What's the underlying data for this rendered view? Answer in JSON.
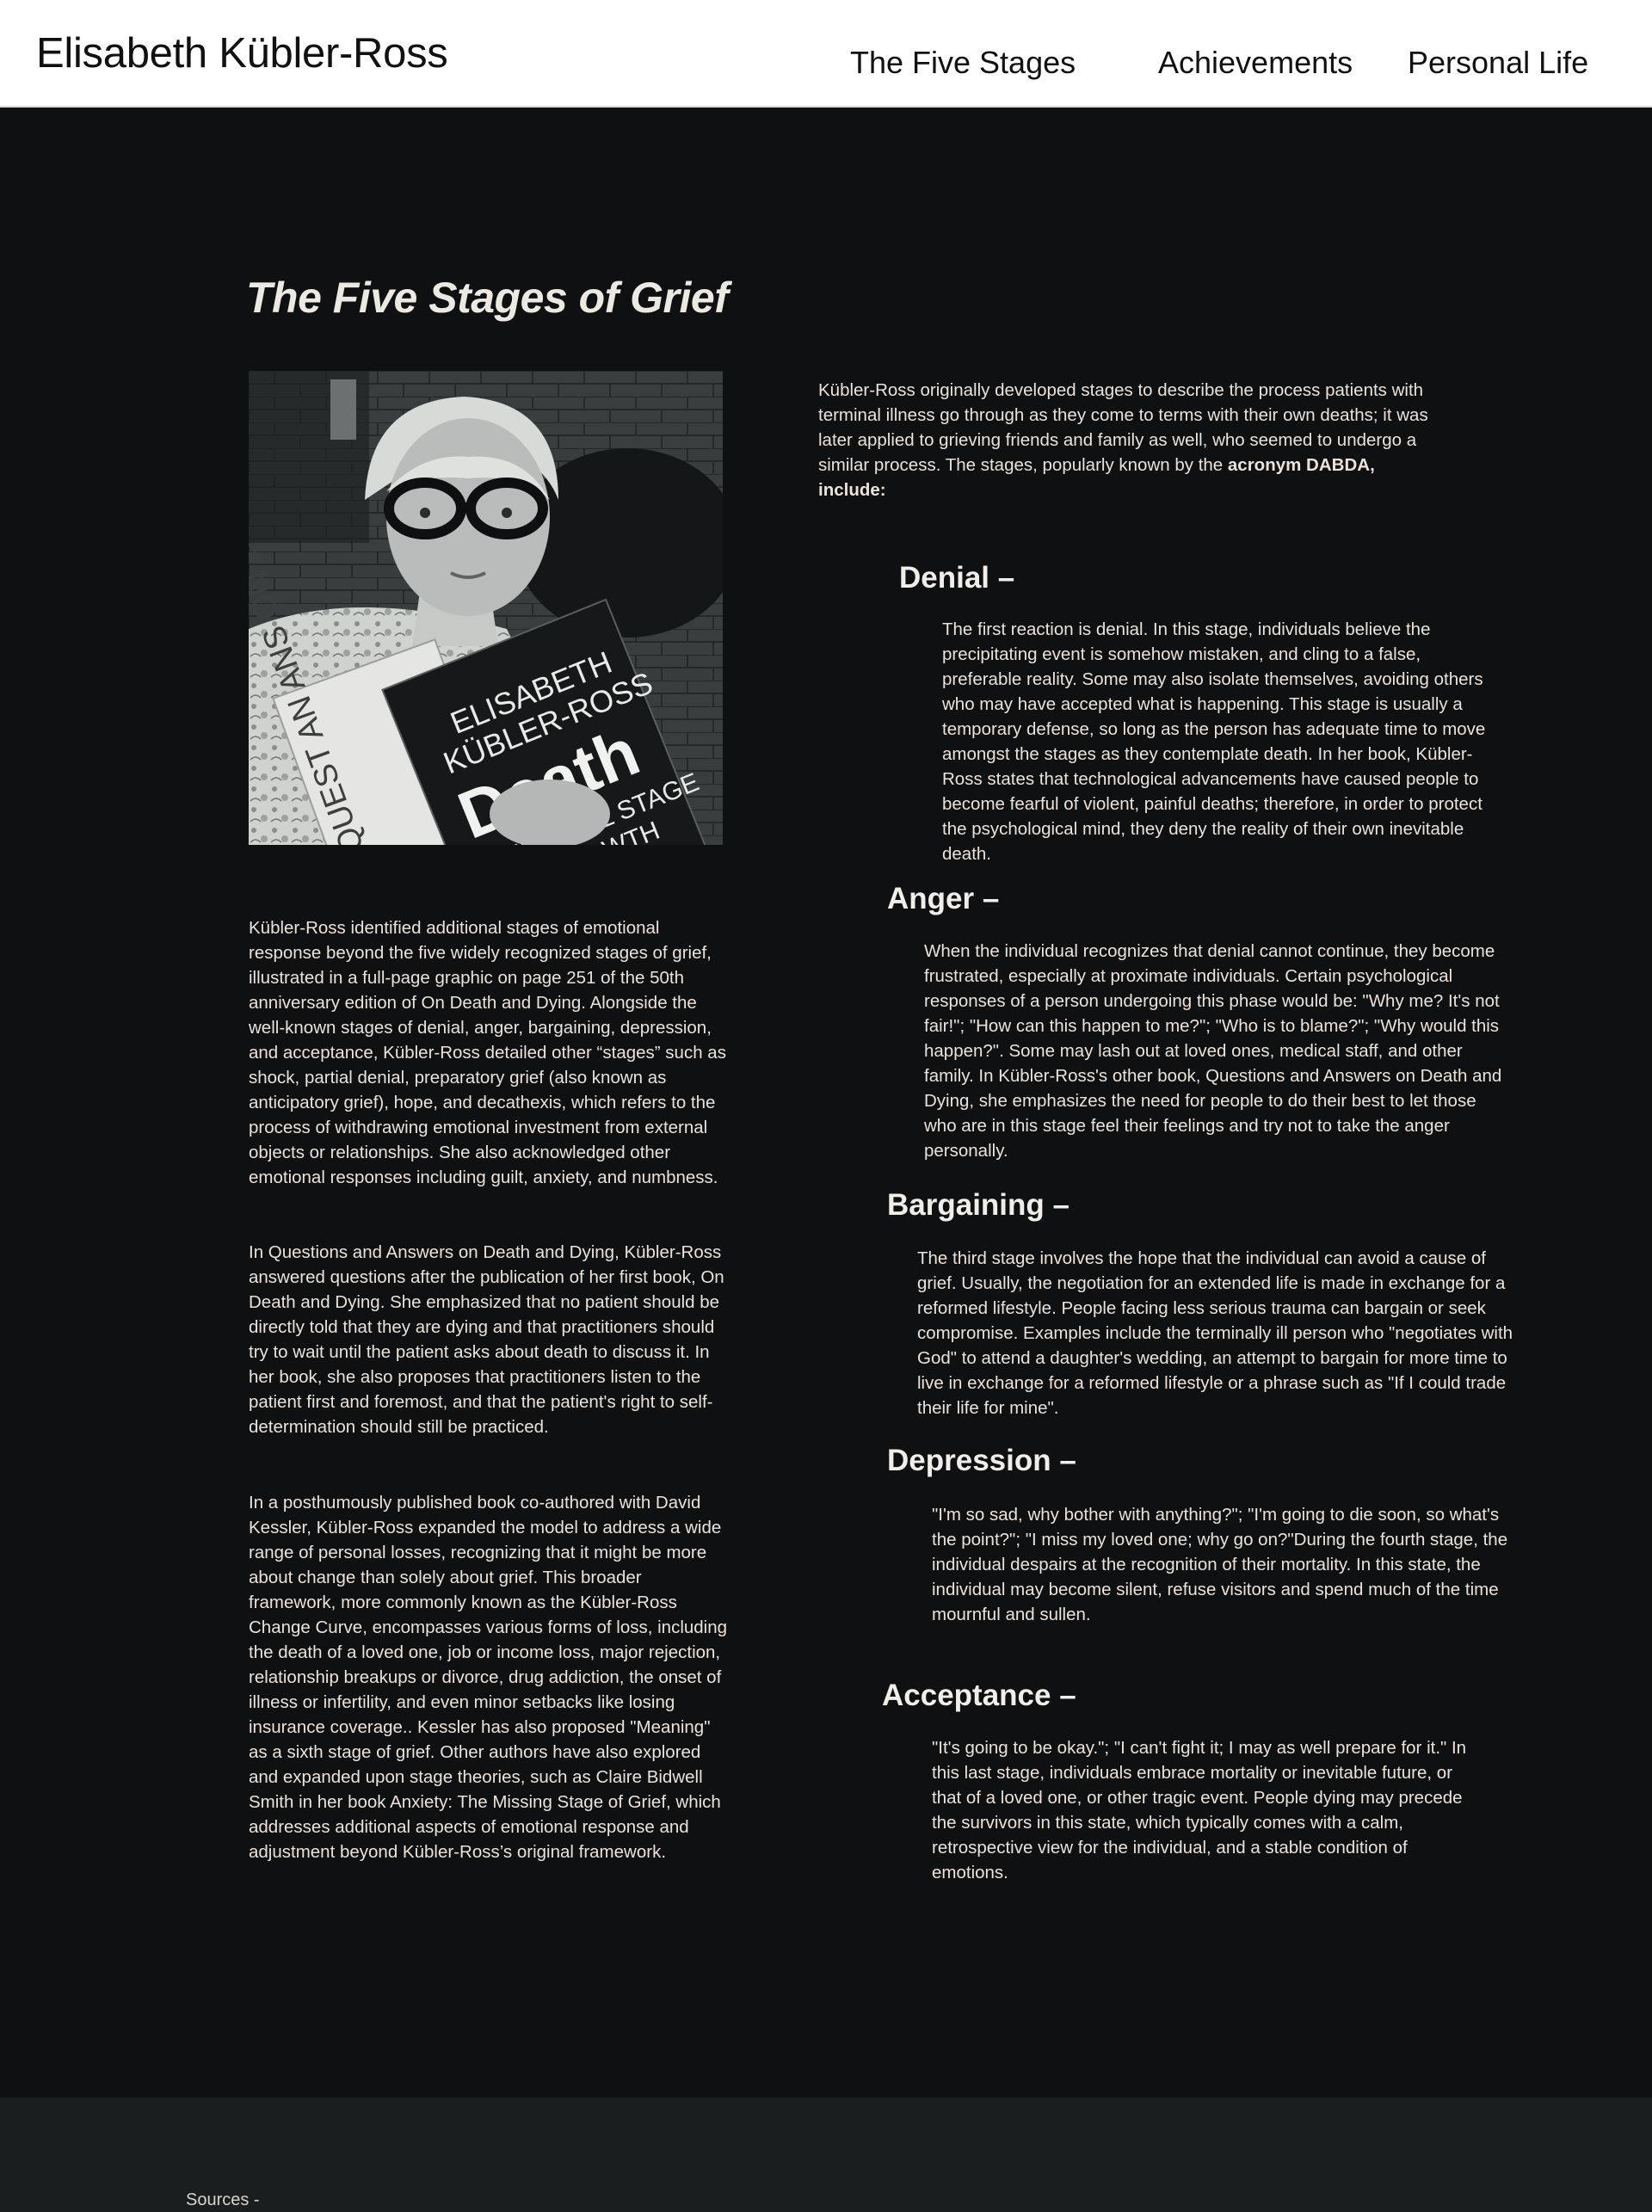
{
  "header": {
    "site_title": "Elisabeth Kübler-Ross",
    "nav": [
      {
        "label": "The Five Stages"
      },
      {
        "label": "Achievements"
      },
      {
        "label": "Personal Life"
      }
    ]
  },
  "main": {
    "title": "The Five Stages of Grief",
    "intro": {
      "text": "Kübler-Ross originally developed stages to describe the process patients with terminal illness go through as they come to terms with their own deaths; it was later applied to grieving friends and family as well, who seemed to undergo a similar process. The stages, popularly known by the ",
      "bold": "acronym DABDA, include:"
    },
    "portrait": {
      "book_author_line1": "ELISABETH",
      "book_author_line2": "KÜBLER-ROSS",
      "book_title": "Death",
      "book_subtitle_line1": "THE FINAL STAGE",
      "book_subtitle_line2": "OF GROWTH",
      "back_book_text": "QUEST AN ANS ON D"
    },
    "left_paragraphs": [
      "Kübler-Ross identified additional stages of emotional response beyond the five widely recognized stages of grief, illustrated in a full-page graphic on page 251 of the 50th anniversary edition of On Death and Dying. Alongside the well-known stages of denial, anger, bargaining, depression, and acceptance, Kübler-Ross detailed other “stages” such as shock, partial denial, preparatory grief (also known as anticipatory grief), hope, and decathexis, which refers to the process of withdrawing emotional investment from external objects or relationships. She also acknowledged other emotional responses including guilt, anxiety, and numbness.",
      "In Questions and Answers on Death and Dying, Kübler-Ross answered questions after the publication of her first book, On Death and Dying. She emphasized that no patient should be directly told that they are dying and that practitioners should try to wait until the patient asks about death to discuss it. In her book, she also proposes that practitioners listen to the patient first and foremost, and that the patient's right to self-determination should still be practiced.",
      "In a posthumously published book co-authored with David Kessler, Kübler-Ross expanded the model to address a wide range of personal losses, recognizing that it might be more about change than solely about grief. This broader framework, more commonly known as the Kübler-Ross Change Curve, encompasses various forms of loss, including the death of a loved one, job or income loss, major rejection, relationship breakups or divorce, drug addiction, the onset of illness or infertility, and even minor setbacks like losing insurance coverage.. Kessler has also proposed \"Meaning\" as a sixth stage of grief. Other authors have also explored and expanded upon stage theories, such as Claire Bidwell Smith in her book Anxiety: The Missing Stage of Grief, which addresses additional aspects of emotional response and adjustment beyond Kübler-Ross’s original framework."
    ],
    "stages": [
      {
        "heading": "Denial –",
        "text": "The first reaction is denial. In this stage, individuals believe the precipitating event is somehow mistaken, and cling to a false, preferable reality. Some may also isolate themselves, avoiding others who may have accepted what is happening. This stage is usually a temporary defense, so long as the person has adequate time to move amongst the stages as they contemplate death. In her book, Kübler-Ross states that technological advancements have caused people to become fearful of violent, painful deaths; therefore, in order to protect the psychological mind, they deny the reality of their own inevitable death."
      },
      {
        "heading": "Anger –",
        "text": "When the individual recognizes that denial cannot continue, they become frustrated, especially at proximate individuals. Certain psychological responses of a person undergoing this phase would be: \"Why me? It's not fair!\"; \"How can this happen to me?\"; \"Who is to blame?\"; \"Why would this happen?\". Some may lash out at loved ones, medical staff, and other family. In Kübler-Ross's other book, Questions and Answers on Death and Dying, she emphasizes the need for people to do their best to let those who are in this stage feel their feelings and try not to take the anger personally."
      },
      {
        "heading": "Bargaining –",
        "text": "The third stage involves the hope that the individual can avoid a cause of grief. Usually, the negotiation for an extended life is made in exchange for a reformed lifestyle. People facing less serious trauma can bargain or seek compromise. Examples include the terminally ill person who \"negotiates with God\" to attend a daughter's wedding, an attempt to bargain for more time to live in exchange for a reformed lifestyle or a phrase such as \"If I could trade their life for mine\"."
      },
      {
        "heading": "Depression –",
        "text": "\"I'm so sad, why bother with anything?\"; \"I'm going to die soon, so what's the point?\"; \"I miss my loved one; why go on?\"During the fourth stage, the individual despairs at the recognition of their mortality. In this state, the individual may become silent, refuse visitors and spend much of the time mournful and sullen."
      },
      {
        "heading": "Acceptance –",
        "text": "\"It's going to be okay.\"; \"I can't fight it; I may as well prepare for it.\" In this last stage, individuals embrace mortality or inevitable future, or that of a loved one, or other tragic event. People dying may precede the survivors in this state, which typically comes with a calm, retrospective view for the individual, and a stable condition of emotions."
      }
    ]
  },
  "footer": {
    "sources_label": "Sources -"
  }
}
